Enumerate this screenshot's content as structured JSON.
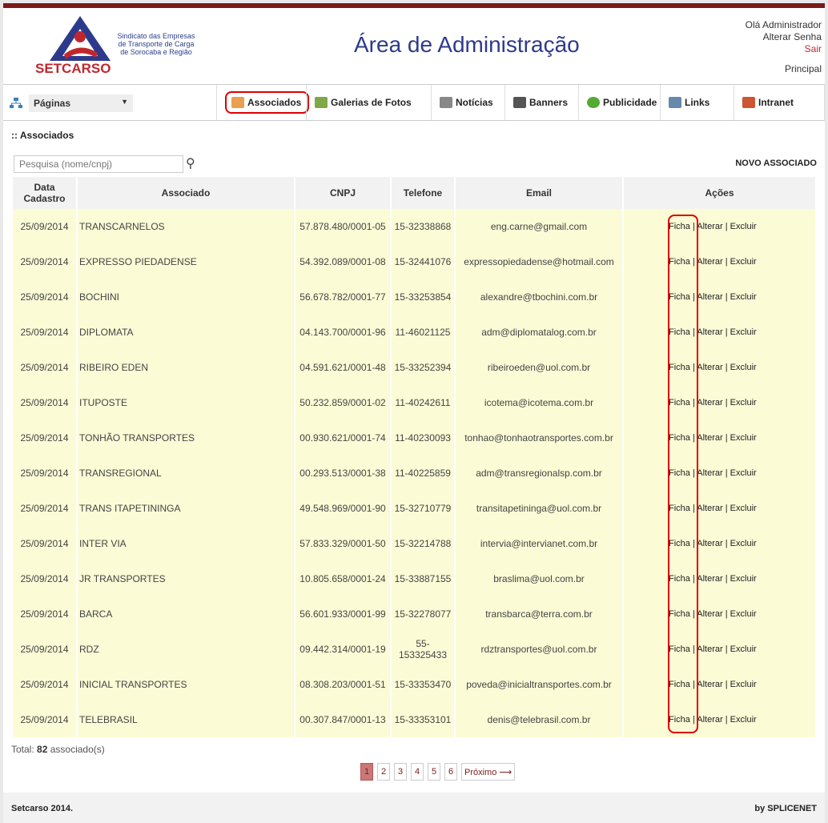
{
  "header": {
    "logo_text": "SETCARSO",
    "logo_sub": [
      "Sindicato das Empresas",
      "de Transporte de Carga",
      "de Sorocaba e Região"
    ],
    "title": "Área de Administração",
    "greeting": "Olá Administrador",
    "change_password": "Alterar Senha",
    "logout": "Sair",
    "home": "Principal"
  },
  "nav": {
    "pages_select": "Páginas",
    "items": [
      {
        "label": "Associados",
        "icon": "handshake-icon",
        "color": "#e8a050"
      },
      {
        "label": "Galerias de Fotos",
        "icon": "photo-gallery-icon",
        "color": "#7fa84a"
      },
      {
        "label": "Notícias",
        "icon": "news-icon",
        "color": "#888888"
      },
      {
        "label": "Banners",
        "icon": "banner-icon",
        "color": "#555555"
      },
      {
        "label": "Publicidade",
        "icon": "globe-icon",
        "color": "#55aa33"
      },
      {
        "label": "Links",
        "icon": "link-icon",
        "color": "#6688aa"
      },
      {
        "label": "Intranet",
        "icon": "users-icon",
        "color": "#cc5533"
      }
    ]
  },
  "content": {
    "section_title": ":: Associados",
    "search_placeholder": "Pesquisa (nome/cnpj)",
    "new_button": "NOVO ASSOCIADO",
    "columns": [
      "Data Cadastro",
      "Associado",
      "CNPJ",
      "Telefone",
      "Email",
      "Ações"
    ],
    "actions": {
      "view": "Ficha",
      "edit": "Alterar",
      "delete": "Excluir",
      "sep": "|"
    },
    "rows": [
      {
        "date": "25/09/2014",
        "name": "TRANSCARNELOS",
        "cnpj": "57.878.480/0001-05",
        "phone": "15-32338868",
        "email": "eng.carne@gmail.com"
      },
      {
        "date": "25/09/2014",
        "name": "EXPRESSO PIEDADENSE",
        "cnpj": "54.392.089/0001-08",
        "phone": "15-32441076",
        "email": "expressopiedadense@hotmail.com"
      },
      {
        "date": "25/09/2014",
        "name": "BOCHINI",
        "cnpj": "56.678.782/0001-77",
        "phone": "15-33253854",
        "email": "alexandre@tbochini.com.br"
      },
      {
        "date": "25/09/2014",
        "name": "DIPLOMATA",
        "cnpj": "04.143.700/0001-96",
        "phone": "11-46021125",
        "email": "adm@diplomatalog.com.br"
      },
      {
        "date": "25/09/2014",
        "name": "RIBEIRO EDEN",
        "cnpj": "04.591.621/0001-48",
        "phone": "15-33252394",
        "email": "ribeiroeden@uol.com.br"
      },
      {
        "date": "25/09/2014",
        "name": "ITUPOSTE",
        "cnpj": "50.232.859/0001-02",
        "phone": "11-40242611",
        "email": "icotema@icotema.com.br"
      },
      {
        "date": "25/09/2014",
        "name": "TONHÃO TRANSPORTES",
        "cnpj": "00.930.621/0001-74",
        "phone": "11-40230093",
        "email": "tonhao@tonhaotransportes.com.br"
      },
      {
        "date": "25/09/2014",
        "name": "TRANSREGIONAL",
        "cnpj": "00.293.513/0001-38",
        "phone": "11-40225859",
        "email": "adm@transregionalsp.com.br"
      },
      {
        "date": "25/09/2014",
        "name": "TRANS ITAPETININGA",
        "cnpj": "49.548.969/0001-90",
        "phone": "15-32710779",
        "email": "transitapetininga@uol.com.br"
      },
      {
        "date": "25/09/2014",
        "name": "INTER VIA",
        "cnpj": "57.833.329/0001-50",
        "phone": "15-32214788",
        "email": "intervia@intervianet.com.br"
      },
      {
        "date": "25/09/2014",
        "name": "JR TRANSPORTES",
        "cnpj": "10.805.658/0001-24",
        "phone": "15-33887155",
        "email": "braslima@uol.com.br"
      },
      {
        "date": "25/09/2014",
        "name": "BARCA",
        "cnpj": "56.601.933/0001-99",
        "phone": "15-32278077",
        "email": "transbarca@terra.com.br"
      },
      {
        "date": "25/09/2014",
        "name": "RDZ",
        "cnpj": "09.442.314/0001-19",
        "phone": "55-153325433",
        "email": "rdztransportes@uol.com.br"
      },
      {
        "date": "25/09/2014",
        "name": "INICIAL TRANSPORTES",
        "cnpj": "08.308.203/0001-51",
        "phone": "15-33353470",
        "email": "poveda@inicialtransportes.com.br"
      },
      {
        "date": "25/09/2014",
        "name": "TELEBRASIL",
        "cnpj": "00.307.847/0001-13",
        "phone": "15-33353101",
        "email": "denis@telebrasil.com.br"
      }
    ],
    "total_label": "Total:",
    "total_count": "82",
    "total_suffix": "associado(s)"
  },
  "pager": {
    "pages": [
      "1",
      "2",
      "3",
      "4",
      "5",
      "6"
    ],
    "current": "1",
    "next": "Próximo ⟶"
  },
  "footer": {
    "left": "Setcarso 2014.",
    "right": "by SPLICENET"
  },
  "colors": {
    "brand_red": "#c0272d",
    "title_blue": "#2d3a8c",
    "row_bg": "#fbfbd6",
    "highlight": "#dd0000"
  }
}
